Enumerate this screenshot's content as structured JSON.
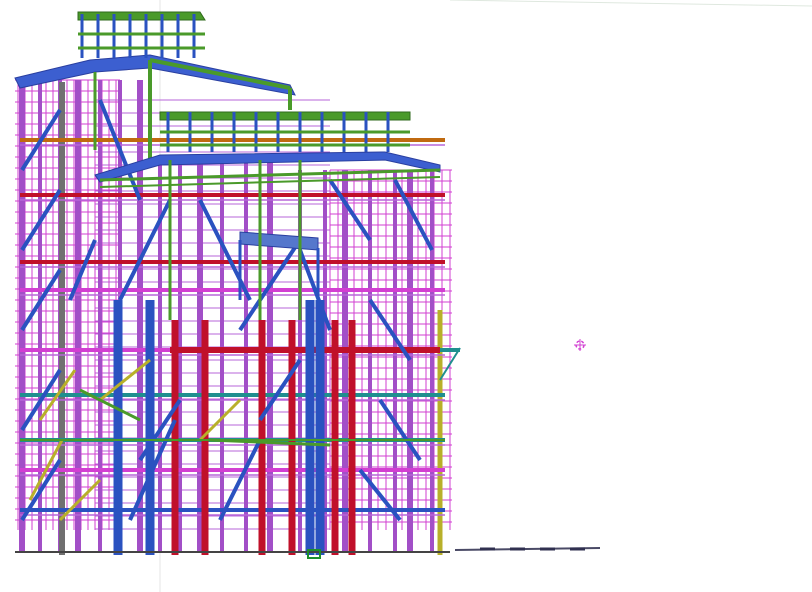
{
  "viewport": {
    "background": "#ffffff"
  },
  "model": {
    "view_mode": "3d-structural-steel-frame",
    "member_colors": {
      "column": "#a24fc7",
      "beam_magenta": "#d23fd2",
      "brace_blue": "#2a52c0",
      "roof_blue": "#3c5fd0",
      "roof_green": "#4a9a2a",
      "beam_red": "#c0102a",
      "beam_yellow": "#b8b02a",
      "beam_teal": "#1f8f8f",
      "column_gray": "#707070",
      "beam_orange": "#c06a10"
    }
  },
  "cursor": {
    "icon": "crosshair-target-icon",
    "color": "#d23fd2"
  },
  "axis": {
    "icon": "axis-origin-icon",
    "color": "#1c8f2c"
  }
}
